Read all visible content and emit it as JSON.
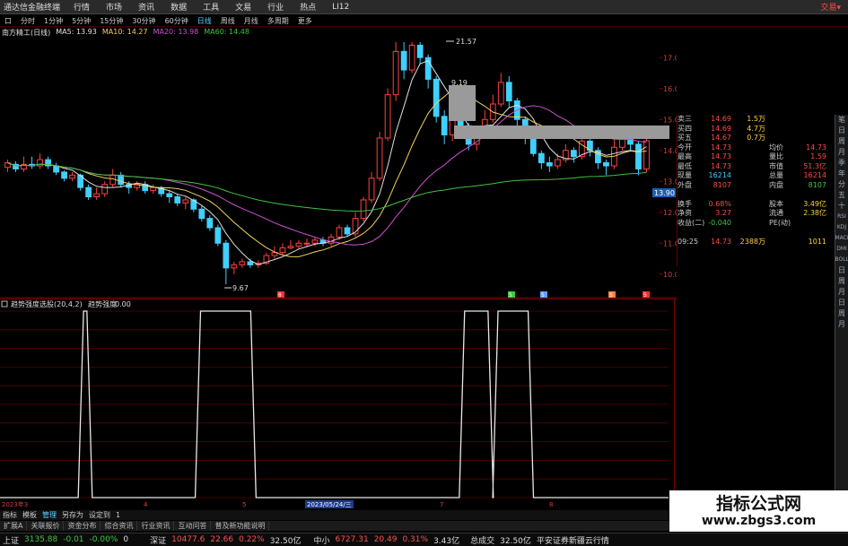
{
  "menu": {
    "app_name": "通达信金融终端",
    "items": [
      "行情",
      "市场",
      "资讯",
      "数据",
      "工具",
      "文易",
      "行业",
      "热点",
      "LI12"
    ],
    "trade": "交易▾"
  },
  "periods": {
    "items": [
      "口",
      "分时",
      "1分钟",
      "5分钟",
      "15分钟",
      "30分钟",
      "60分钟",
      "日线",
      "周线",
      "月线",
      "多周期",
      "更多"
    ],
    "active_index": 7
  },
  "ma_legend": {
    "stock": "南方精工(日线)",
    "ma5": "MA5: 13.93",
    "ma10": "MA10: 14.27",
    "ma20": "MA20: 13.98",
    "ma60": "MA60: 14.48",
    "colors": {
      "stock": "#e0e0e0",
      "ma5": "#e0e0e0",
      "ma10": "#f0d060",
      "ma20": "#d050d0",
      "ma60": "#40c040"
    }
  },
  "chart_data": [
    {
      "type": "candlestick",
      "title": "南方精工(日线)",
      "price_axis": [
        "17.00",
        "16.00",
        "15.00",
        "14.00",
        "13.00",
        "12.00",
        "11.00",
        "10.00"
      ],
      "ylim": [
        9.5,
        17.5
      ],
      "annotations": {
        "high": "21.57",
        "low": "9.67",
        "mid": "9.19",
        "current": "14.31",
        "current_box": "13.90"
      },
      "day_markers": [
        "8",
        "5",
        "5",
        "S",
        "5"
      ],
      "candles": [
        {
          "o": 13.45,
          "c": 13.6,
          "h": 13.7,
          "l": 13.3
        },
        {
          "o": 13.55,
          "c": 13.4,
          "h": 13.65,
          "l": 13.3
        },
        {
          "o": 13.4,
          "c": 13.55,
          "h": 13.8,
          "l": 13.3
        },
        {
          "o": 13.55,
          "c": 13.5,
          "h": 13.8,
          "l": 13.4
        },
        {
          "o": 13.5,
          "c": 13.7,
          "h": 13.9,
          "l": 13.4
        },
        {
          "o": 13.7,
          "c": 13.5,
          "h": 13.8,
          "l": 13.4
        },
        {
          "o": 13.5,
          "c": 13.3,
          "h": 13.6,
          "l": 13.2
        },
        {
          "o": 13.3,
          "c": 13.1,
          "h": 13.35,
          "l": 13.0
        },
        {
          "o": 13.1,
          "c": 13.2,
          "h": 13.3,
          "l": 13.0
        },
        {
          "o": 13.2,
          "c": 12.8,
          "h": 13.25,
          "l": 12.7
        },
        {
          "o": 12.8,
          "c": 12.5,
          "h": 12.9,
          "l": 12.4
        },
        {
          "o": 12.5,
          "c": 12.6,
          "h": 12.8,
          "l": 12.4
        },
        {
          "o": 12.6,
          "c": 12.9,
          "h": 13.0,
          "l": 12.5
        },
        {
          "o": 12.9,
          "c": 13.2,
          "h": 13.4,
          "l": 12.8
        },
        {
          "o": 13.2,
          "c": 12.9,
          "h": 13.3,
          "l": 12.8
        },
        {
          "o": 12.9,
          "c": 12.8,
          "h": 13.0,
          "l": 12.6
        },
        {
          "o": 12.8,
          "c": 12.9,
          "h": 13.0,
          "l": 12.7
        },
        {
          "o": 12.9,
          "c": 12.7,
          "h": 13.0,
          "l": 12.6
        },
        {
          "o": 12.7,
          "c": 12.8,
          "h": 12.9,
          "l": 12.6
        },
        {
          "o": 12.8,
          "c": 12.6,
          "h": 12.85,
          "l": 12.5
        },
        {
          "o": 12.6,
          "c": 12.5,
          "h": 12.7,
          "l": 12.3
        },
        {
          "o": 12.5,
          "c": 12.3,
          "h": 12.6,
          "l": 12.2
        },
        {
          "o": 12.3,
          "c": 12.4,
          "h": 12.5,
          "l": 12.1
        },
        {
          "o": 12.4,
          "c": 12.1,
          "h": 12.45,
          "l": 12.0
        },
        {
          "o": 12.1,
          "c": 11.8,
          "h": 12.2,
          "l": 11.7
        },
        {
          "o": 11.8,
          "c": 11.5,
          "h": 11.9,
          "l": 11.4
        },
        {
          "o": 11.5,
          "c": 11.0,
          "h": 11.6,
          "l": 10.9
        },
        {
          "o": 11.0,
          "c": 10.2,
          "h": 11.1,
          "l": 9.67
        },
        {
          "o": 10.2,
          "c": 10.3,
          "h": 10.4,
          "l": 10.0
        },
        {
          "o": 10.3,
          "c": 10.4,
          "h": 10.5,
          "l": 10.2
        },
        {
          "o": 10.4,
          "c": 10.3,
          "h": 10.5,
          "l": 10.2
        },
        {
          "o": 10.3,
          "c": 10.35,
          "h": 10.45,
          "l": 10.2
        },
        {
          "o": 10.35,
          "c": 10.6,
          "h": 10.7,
          "l": 10.3
        },
        {
          "o": 10.6,
          "c": 10.7,
          "h": 10.9,
          "l": 10.5
        },
        {
          "o": 10.7,
          "c": 10.85,
          "h": 11.0,
          "l": 10.6
        },
        {
          "o": 10.85,
          "c": 10.9,
          "h": 11.1,
          "l": 10.8
        },
        {
          "o": 10.9,
          "c": 11.0,
          "h": 11.1,
          "l": 10.8
        },
        {
          "o": 11.0,
          "c": 11.0,
          "h": 11.15,
          "l": 10.9
        },
        {
          "o": 11.0,
          "c": 11.1,
          "h": 11.2,
          "l": 10.9
        },
        {
          "o": 11.1,
          "c": 11.0,
          "h": 11.2,
          "l": 10.9
        },
        {
          "o": 11.0,
          "c": 11.2,
          "h": 11.3,
          "l": 10.9
        },
        {
          "o": 11.2,
          "c": 11.5,
          "h": 11.6,
          "l": 11.1
        },
        {
          "o": 11.5,
          "c": 11.3,
          "h": 11.6,
          "l": 11.2
        },
        {
          "o": 11.3,
          "c": 11.8,
          "h": 12.0,
          "l": 11.2
        },
        {
          "o": 11.8,
          "c": 12.4,
          "h": 12.5,
          "l": 11.7
        },
        {
          "o": 12.4,
          "c": 13.1,
          "h": 13.3,
          "l": 12.3
        },
        {
          "o": 13.1,
          "c": 14.4,
          "h": 14.6,
          "l": 13.0
        },
        {
          "o": 14.4,
          "c": 15.8,
          "h": 16.0,
          "l": 14.3
        },
        {
          "o": 15.8,
          "c": 17.2,
          "h": 17.5,
          "l": 15.6
        },
        {
          "o": 17.2,
          "c": 16.6,
          "h": 17.5,
          "l": 16.3
        },
        {
          "o": 16.6,
          "c": 17.4,
          "h": 17.5,
          "l": 16.5
        },
        {
          "o": 17.4,
          "c": 17.0,
          "h": 17.5,
          "l": 16.8
        },
        {
          "o": 17.0,
          "c": 16.3,
          "h": 17.1,
          "l": 16.0
        },
        {
          "o": 16.3,
          "c": 15.1,
          "h": 16.4,
          "l": 14.9
        },
        {
          "o": 15.1,
          "c": 14.5,
          "h": 15.3,
          "l": 14.2
        },
        {
          "o": 14.5,
          "c": 15.4,
          "h": 15.6,
          "l": 14.3
        },
        {
          "o": 15.4,
          "c": 14.8,
          "h": 15.5,
          "l": 14.5
        },
        {
          "o": 14.8,
          "c": 14.2,
          "h": 14.9,
          "l": 14.0
        },
        {
          "o": 14.2,
          "c": 14.6,
          "h": 14.8,
          "l": 14.0
        },
        {
          "o": 14.6,
          "c": 15.0,
          "h": 15.3,
          "l": 14.5
        },
        {
          "o": 15.0,
          "c": 15.5,
          "h": 15.8,
          "l": 14.9
        },
        {
          "o": 15.5,
          "c": 16.2,
          "h": 16.5,
          "l": 15.4
        },
        {
          "o": 16.2,
          "c": 15.6,
          "h": 16.4,
          "l": 15.4
        },
        {
          "o": 15.6,
          "c": 15.0,
          "h": 15.7,
          "l": 14.8
        },
        {
          "o": 15.0,
          "c": 14.4,
          "h": 15.1,
          "l": 14.2
        },
        {
          "o": 14.4,
          "c": 13.9,
          "h": 14.5,
          "l": 13.8
        },
        {
          "o": 13.9,
          "c": 13.6,
          "h": 14.0,
          "l": 13.4
        },
        {
          "o": 13.6,
          "c": 13.5,
          "h": 13.8,
          "l": 13.3
        },
        {
          "o": 13.5,
          "c": 13.7,
          "h": 13.9,
          "l": 13.4
        },
        {
          "o": 13.7,
          "c": 14.0,
          "h": 14.2,
          "l": 13.6
        },
        {
          "o": 14.0,
          "c": 13.8,
          "h": 14.1,
          "l": 13.6
        },
        {
          "o": 13.8,
          "c": 14.3,
          "h": 14.5,
          "l": 13.7
        },
        {
          "o": 14.3,
          "c": 14.0,
          "h": 14.4,
          "l": 13.8
        },
        {
          "o": 14.0,
          "c": 13.6,
          "h": 14.1,
          "l": 13.4
        },
        {
          "o": 13.6,
          "c": 13.5,
          "h": 13.7,
          "l": 13.2
        },
        {
          "o": 13.5,
          "c": 14.1,
          "h": 14.4,
          "l": 13.4
        },
        {
          "o": 14.1,
          "c": 14.6,
          "h": 14.8,
          "l": 14.0
        },
        {
          "o": 14.6,
          "c": 14.2,
          "h": 14.7,
          "l": 14.0
        },
        {
          "o": 14.2,
          "c": 13.4,
          "h": 14.3,
          "l": 13.2
        },
        {
          "o": 13.4,
          "c": 14.31,
          "h": 14.5,
          "l": 13.3
        }
      ]
    },
    {
      "type": "line",
      "title": "趋势强度选股(20,4,2)",
      "series": [
        {
          "name": "趋势强度",
          "value": "0.00"
        }
      ],
      "y_axis": [
        "1.00",
        "0.90",
        "0.80",
        "0.70",
        "0.60",
        "0.50",
        "0.40",
        "0.30",
        "0.20",
        "0.10",
        "0.00"
      ],
      "ylim": [
        0,
        1
      ],
      "x_labels": [
        "2023年3",
        "4",
        "5",
        "2023/05/24/三",
        "7",
        "8"
      ],
      "pulses": [
        [
          0.125,
          0.13
        ],
        [
          0.3,
          0.375
        ],
        [
          0.695,
          0.73
        ],
        [
          0.745,
          0.79
        ]
      ]
    }
  ],
  "price_panel": {
    "rows": [
      {
        "l1": "卖三",
        "v1": "14.69",
        "v2": "1.5万",
        "l2": "",
        "v3": ""
      },
      {
        "l1": "买四",
        "v1": "14.69",
        "v2": "4.7万",
        "l2": "",
        "v3": ""
      },
      {
        "l1": "买五",
        "v1": "14.67",
        "v2": "0.7万",
        "l2": "",
        "v3": ""
      },
      {
        "l1": "今开",
        "v1": "14.73",
        "v2": "",
        "l2": "均价",
        "v3": "14.73"
      },
      {
        "l1": "最高",
        "v1": "14.73",
        "v2": "",
        "l2": "量比",
        "v3": "1.59"
      },
      {
        "l1": "最低",
        "v1": "14.73",
        "v2": "",
        "l2": "市值",
        "v3": "51.3亿"
      },
      {
        "l1": "现量",
        "v1": "16214",
        "v2": "",
        "l2": "总量",
        "v3": "16214"
      },
      {
        "l1": "外盘",
        "v1": "8107",
        "v2": "",
        "l2": "内盘",
        "v3": "8107"
      },
      {
        "l1": "",
        "v1": "",
        "v2": "",
        "l2": "",
        "v3": ""
      },
      {
        "l1": "换手",
        "v1": "0.68%",
        "v2": "",
        "l2": "股本",
        "v3": "3.49亿"
      },
      {
        "l1": "净资",
        "v1": "3.27",
        "v2": "",
        "l2": "流通",
        "v3": "2.38亿"
      },
      {
        "l1": "收益(二)",
        "v1": "-0.040",
        "v2": "",
        "l2": "PE(动)",
        "v3": ""
      },
      {
        "l1": "",
        "v1": "",
        "v2": "",
        "l2": "",
        "v3": ""
      },
      {
        "l1": "09:25",
        "v1": "14.73",
        "v2": "2388万",
        "l2": "",
        "v3": "1011"
      }
    ]
  },
  "side_tabs": [
    "笔",
    "日",
    "周",
    "月",
    "季",
    "年",
    "分",
    "五",
    "十",
    "RSI",
    "KDJ",
    "MACD",
    "DMI",
    "BOLL",
    "日",
    "周",
    "月",
    "日",
    "周",
    "月"
  ],
  "bottom_toolbar": {
    "items": [
      "指标",
      "模板",
      "管理",
      "另存为",
      "设定到",
      "1"
    ],
    "active_index": 2
  },
  "tab_bar": {
    "items": [
      "扩展A",
      "关联报价",
      "资金分布",
      "综合资讯",
      "行业资讯",
      "互动问答",
      "普及新功能说明"
    ]
  },
  "status": {
    "sh_label": "上证",
    "sh_val": "3135.88",
    "sh_chg": "-0.01",
    "sh_pct": "-0.00%",
    "sh_amt": "0",
    "sz_label": "深证",
    "sz_val": "10477.6",
    "sz_chg": "22.66",
    "sz_pct": "0.22%",
    "sz_amt": "32.50亿",
    "zx_label": "中小",
    "zx_val": "6727.31",
    "zx_chg": "20.49",
    "zx_pct": "0.31%",
    "zx_amt": "3.43亿",
    "total_label": "总成交",
    "total_amt": "32.50亿",
    "news": "平安证券新疆云行情"
  },
  "watermark": {
    "title": "指标公式网",
    "url": "www.zbgs3.com"
  }
}
